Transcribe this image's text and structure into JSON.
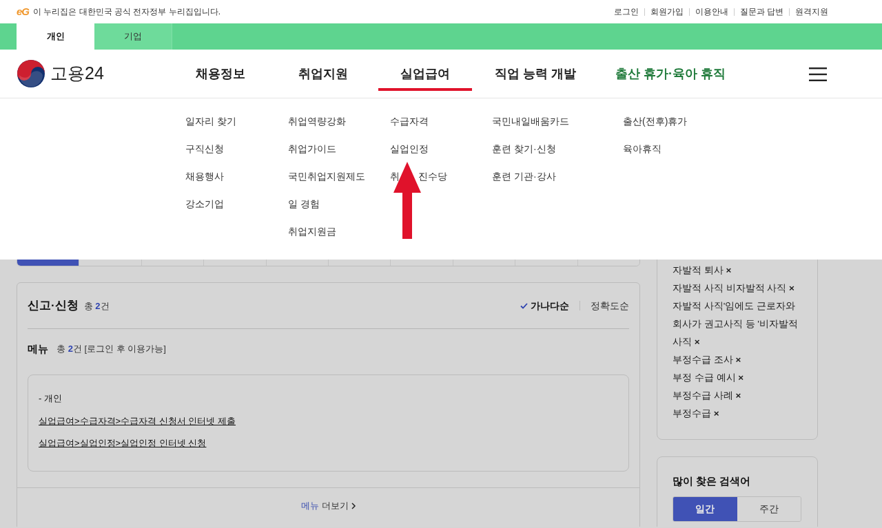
{
  "gov_banner": {
    "logo": "eG",
    "text": "이 누리집은 대한민국 공식 전자정부 누리집입니다."
  },
  "utility_links": [
    "로그인",
    "회원가입",
    "이용안내",
    "질문과 답변",
    "원격지원"
  ],
  "audience_tabs": [
    {
      "label": "개인",
      "selected": true
    },
    {
      "label": "기업",
      "selected": false
    }
  ],
  "brand": "고용24",
  "main_nav": [
    {
      "label": "채용정보",
      "selected": false,
      "highlight": false
    },
    {
      "label": "취업지원",
      "selected": false,
      "highlight": false
    },
    {
      "label": "실업급여",
      "selected": true,
      "highlight": false
    },
    {
      "label": "직업 능력 개발",
      "selected": false,
      "highlight": false
    },
    {
      "label": "출산 휴가·육아 휴직",
      "selected": false,
      "highlight": true
    }
  ],
  "mega_menu": [
    {
      "items": [
        {
          "label": "일자리 찾기"
        },
        {
          "label": "구직신청"
        },
        {
          "label": "채용행사"
        },
        {
          "label": "강소기업"
        }
      ]
    },
    {
      "items": [
        {
          "label": "취업역량강화"
        },
        {
          "label": "취업가이드"
        },
        {
          "label": "국민취업지원제도"
        },
        {
          "label": "일 경험"
        },
        {
          "label": "취업지원금"
        }
      ]
    },
    {
      "items": [
        {
          "label": "수급자격"
        },
        {
          "label": "실업인정"
        },
        {
          "label_parts": [
            "취",
            "진수당"
          ]
        }
      ]
    },
    {
      "items": [
        {
          "label": "국민내일배움카드"
        },
        {
          "label": "훈련 찾기·신청"
        },
        {
          "label": "훈련 기관·강사"
        }
      ]
    },
    {
      "items": [
        {
          "label": "출산(전후)휴가"
        },
        {
          "label": "육아휴직"
        }
      ]
    }
  ],
  "result_tabs": [
    {
      "selected": true
    },
    {
      "selected": false
    },
    {
      "selected": false
    },
    {
      "selected": false
    },
    {
      "selected": false
    },
    {
      "selected": false
    },
    {
      "selected": false
    },
    {
      "selected": false
    },
    {
      "selected": false
    },
    {
      "selected": false
    }
  ],
  "result_card": {
    "title": "신고·신청",
    "count_prefix": "총",
    "count": "2",
    "count_suffix": "건",
    "sort_options": [
      {
        "label": "가나다순",
        "selected": true
      },
      {
        "label": "정확도순",
        "selected": false
      }
    ],
    "section_title": "메뉴",
    "section_count_prefix": "총",
    "section_count": "2",
    "section_count_suffix": "건 [로그인 후 이용가능]",
    "group_label": "- 개인",
    "links": [
      "실업급여>수급자격>수급자격 신청서 인터넷 제출",
      "실업급여>실업인정>실업인정 인터넷 신청"
    ],
    "more_prefix": "메뉴",
    "more_suffix": "더보기"
  },
  "recent_keywords": [
    {
      "label": "자발적 퇴사",
      "remove": "×"
    },
    {
      "label": "자발적 사직 비자발적 사직",
      "remove": "×"
    },
    {
      "label": "자발적 사직'임에도 근로자와 회사가 권고사직 등 '비자발적 사직",
      "remove": "×"
    },
    {
      "label": "부정수급 조사",
      "remove": "×"
    },
    {
      "label": "부정 수급 예시",
      "remove": "×"
    },
    {
      "label": "부정수급 사례",
      "remove": "×"
    },
    {
      "label": "부정수급",
      "remove": "×"
    }
  ],
  "popular": {
    "title": "많이 찾은 검색어",
    "tabs": [
      {
        "label": "일간",
        "selected": true
      },
      {
        "label": "주간",
        "selected": false
      }
    ]
  }
}
